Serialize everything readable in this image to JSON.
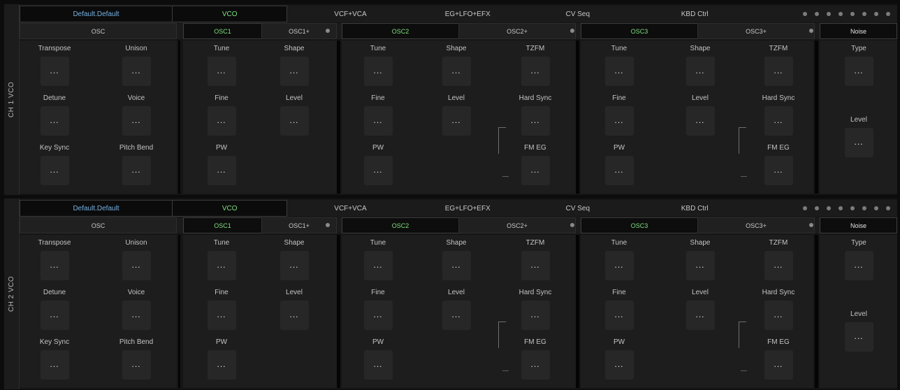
{
  "ch1": {
    "label": "CH 1 VCO",
    "preset": "Default.Default",
    "tabs": [
      "VCO",
      "VCF+VCA",
      "EG+LFO+EFX",
      "CV Seq",
      "KBD Ctrl"
    ],
    "sub": [
      "OSC",
      "OSC1",
      "OSC1+",
      "OSC2",
      "OSC2+",
      "OSC3",
      "OSC3+",
      "Noise"
    ],
    "osc": [
      "Transpose",
      "Unison",
      "Detune",
      "Voice",
      "Key Sync",
      "Pitch Bend"
    ],
    "osc1": [
      "Tune",
      "Shape",
      "Fine",
      "Level",
      "PW"
    ],
    "osc2": [
      "Tune",
      "Shape",
      "TZFM",
      "Fine",
      "Level",
      "Hard Sync",
      "PW",
      "FM EG"
    ],
    "osc3": [
      "Tune",
      "Shape",
      "TZFM",
      "Fine",
      "Level",
      "Hard Sync",
      "PW",
      "FM EG"
    ],
    "noise": [
      "Type",
      "Level"
    ]
  },
  "ch2": {
    "label": "CH 2 VCO",
    "preset": "Default.Default",
    "tabs": [
      "VCO",
      "VCF+VCA",
      "EG+LFO+EFX",
      "CV Seq",
      "KBD Ctrl"
    ],
    "sub": [
      "OSC",
      "OSC1",
      "OSC1+",
      "OSC2",
      "OSC2+",
      "OSC3",
      "OSC3+",
      "Noise"
    ],
    "osc": [
      "Transpose",
      "Unison",
      "Detune",
      "Voice",
      "Key Sync",
      "Pitch Bend"
    ],
    "osc1": [
      "Tune",
      "Shape",
      "Fine",
      "Level",
      "PW"
    ],
    "osc2": [
      "Tune",
      "Shape",
      "TZFM",
      "Fine",
      "Level",
      "Hard Sync",
      "PW",
      "FM EG"
    ],
    "osc3": [
      "Tune",
      "Shape",
      "TZFM",
      "Fine",
      "Level",
      "Hard Sync",
      "PW",
      "FM EG"
    ],
    "noise": [
      "Type",
      "Level"
    ]
  },
  "knob_value": "...",
  "colors": {
    "preset": "#76b2e2",
    "active": "#7ee07e",
    "bg": "#1d1d1d"
  }
}
